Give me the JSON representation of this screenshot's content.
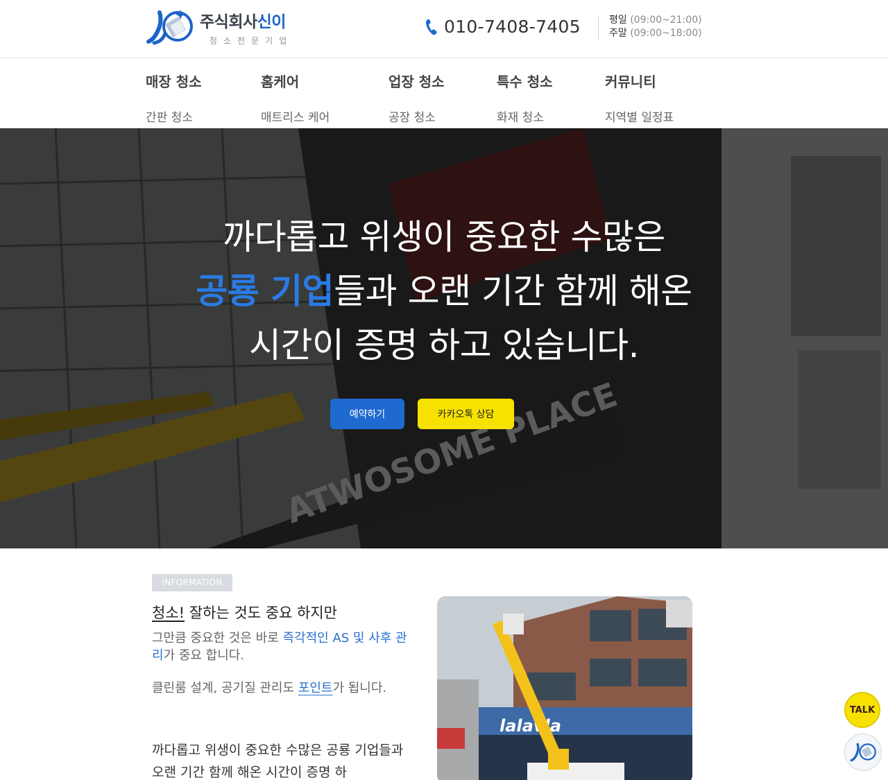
{
  "header": {
    "logo_name_part1": "주식회사",
    "logo_name_part2": "신이",
    "logo_tagline": "청소전문기업",
    "phone": "010-7408-7405",
    "weekday_label": "평일",
    "weekday_hours": "(09:00~21:00)",
    "weekend_label": "주말",
    "weekend_hours": "(09:00~18:00)"
  },
  "nav": {
    "items": [
      {
        "label": "매장 청소",
        "sub": "간판 청소"
      },
      {
        "label": "홈케어",
        "sub": "매트리스 케어"
      },
      {
        "label": "업장 청소",
        "sub": "공장 청소"
      },
      {
        "label": "특수 청소",
        "sub": "화재 청소"
      },
      {
        "label": "커뮤니티",
        "sub": "지역별 일정표"
      }
    ]
  },
  "hero": {
    "line1": "까다롭고 위생이 중요한 수많은",
    "line2_accent": "공룡 기업",
    "line2_rest": "들과 오랜 기간 함께 해온",
    "line3": "시간이 증명 하고 있습니다.",
    "reserve_button": "예약하기",
    "kakao_button": "카카오톡 상담"
  },
  "info": {
    "badge": "INFORMATION",
    "title_underlined": "청소!",
    "title_rest": " 잘하는 것도 중요 하지만",
    "p1_start": "그만큼 중요한 것은 바로 ",
    "p1_link": "즉각적인 AS 및 사후 관리",
    "p1_end": "가 중요 합니다.",
    "p2_start": "클린룸 설계, 공기질 관리도 ",
    "p2_underlined": "포인트",
    "p2_end": "가 됩니다.",
    "p3": "까다롭고 위생이 중요한 수많은 공룡 기업들과 오랜 기간 함께 해온 시간이 증명 하"
  },
  "floating": {
    "talk_label": "TALK"
  },
  "colors": {
    "brand_blue": "#1e6ad0",
    "kakao_yellow": "#f7e100"
  }
}
